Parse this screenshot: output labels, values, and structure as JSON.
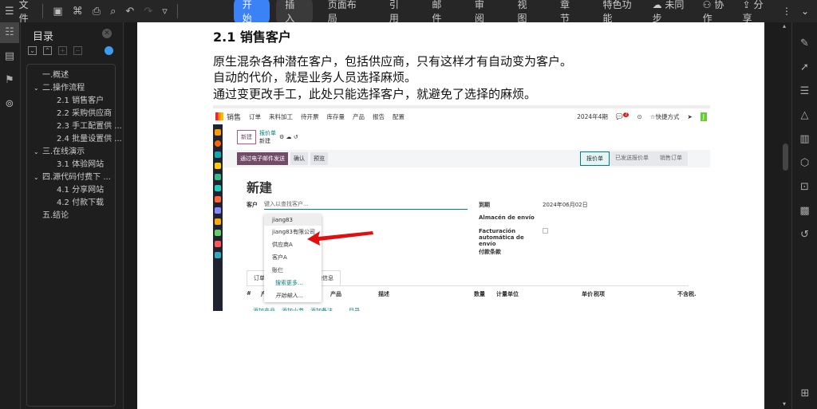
{
  "toolbar": {
    "menu_label": "文件",
    "tabs": [
      "开始",
      "插入",
      "页面布局",
      "引用",
      "邮件",
      "审阅",
      "视图",
      "章节",
      "特色功能"
    ],
    "sync": "未同步",
    "collab": "协作",
    "share": "分享"
  },
  "toc": {
    "title": "目录",
    "items": [
      {
        "label": "一.概述",
        "level": 1,
        "expand": false
      },
      {
        "label": "二.操作流程",
        "level": 1,
        "expand": true
      },
      {
        "label": "2.1 销售客户",
        "level": 2
      },
      {
        "label": "2.2 采购供应商",
        "level": 2
      },
      {
        "label": "2.3 手工配置供 ...",
        "level": 2
      },
      {
        "label": "2.4 批量设置供 ...",
        "level": 2
      },
      {
        "label": "三.在线演示",
        "level": 1,
        "expand": true
      },
      {
        "label": "3.1 体验网站",
        "level": 2
      },
      {
        "label": "四.源代码付费下 ...",
        "level": 1,
        "expand": true
      },
      {
        "label": "4.1 分享网站",
        "level": 2
      },
      {
        "label": "4.2 付款下载",
        "level": 2
      },
      {
        "label": "五.结论",
        "level": 1,
        "expand": false
      }
    ]
  },
  "doc": {
    "heading": "2.1 销售客户",
    "paras": [
      "原生混杂各种潜在客户，包括供应商，只有这样才有自动变为客户。",
      "自动的代价，就是业务人员选择麻烦。",
      "通过变更改手工，此处只能选择客户，就避免了选择的麻烦。"
    ]
  },
  "odoo": {
    "app": "销售",
    "nav": [
      "订单",
      "来料加工",
      "待开票",
      "库存量",
      "产品",
      "报告",
      "配置"
    ],
    "period": "2024年4期",
    "badge": "2",
    "shortcut": "☆快捷方式",
    "avatar": "J",
    "new_btn": "新建",
    "breadcrumb": "报价单",
    "record": "新建",
    "actions": [
      "通过电子邮件发送",
      "确认",
      "预览"
    ],
    "stages": [
      "报价单",
      "已发送报价单",
      "销售订单"
    ],
    "title": "新建",
    "customer_label": "客户",
    "customer_placeholder": "键入以查找客户...",
    "dropdown": [
      "jiang83",
      "jiang83有限公司",
      "供应商A",
      "客户A",
      "账仨"
    ],
    "search_more": "搜索更多...",
    "start_typing": "开始输入...",
    "fields": [
      {
        "label": "到期",
        "value": "2024年06月02日"
      },
      {
        "label": "Almacén de envío",
        "value": ""
      },
      {
        "label": "Facturación automática de envío",
        "value": ""
      },
      {
        "label": "付款条款",
        "value": ""
      }
    ],
    "tabs": [
      "订单",
      "其他信息"
    ],
    "cols": [
      "#",
      "产品系列",
      "产品",
      "描述",
      "数量",
      "计量单位",
      "单价",
      "税项",
      "不含税."
    ],
    "add_links": [
      "添加产品",
      "添加小节",
      "添加备注",
      "目录"
    ],
    "accent": "#714b67",
    "teal": "#017e84"
  }
}
